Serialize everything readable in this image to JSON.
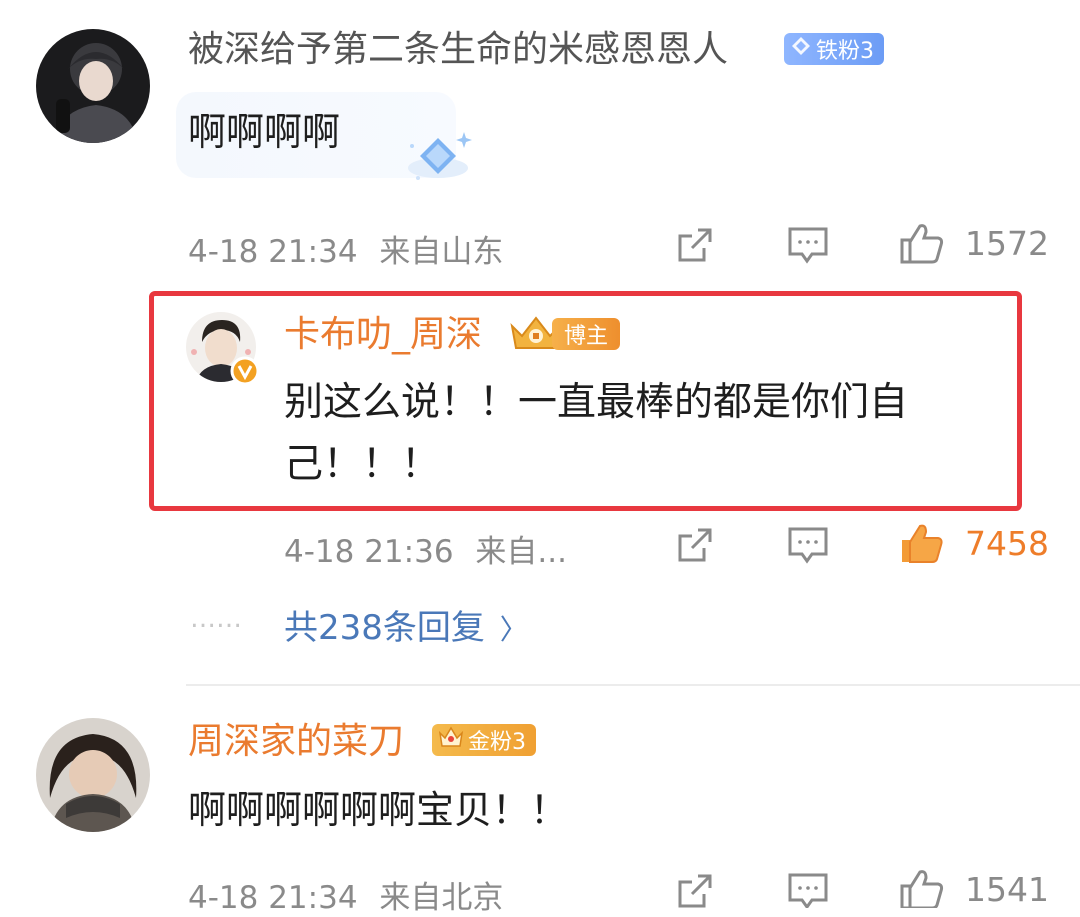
{
  "comments": [
    {
      "username": "被深给予第二条生命的米感恩恩人",
      "badge": "铁粉3",
      "text": "啊啊啊啊",
      "time": "4-18 21:34",
      "location": "来自山东",
      "likes": "1572"
    },
    {
      "username": "周深家的菜刀",
      "badge": "金粉3",
      "text": "啊啊啊啊啊啊宝贝！！",
      "time": "4-18 21:34",
      "location": "来自北京",
      "likes": "1541"
    }
  ],
  "reply": {
    "username": "卡布叻_周深",
    "badge": "博主",
    "text_line1": "别这么说！！一直最棒的都是你们自",
    "text_line2": "己！！！",
    "time": "4-18 21:36",
    "location": "来自...",
    "likes": "7458",
    "highlight_color": "#e8383f"
  },
  "more_replies": {
    "dots": "……",
    "label": "共238条回复",
    "chevron": "〉"
  },
  "colors": {
    "orange_accent": "#ea7b2f",
    "link_blue": "#4a78b8",
    "meta_gray": "#8a8a8a"
  },
  "icons": [
    "share-icon",
    "comment-icon",
    "like-icon",
    "diamond-icon",
    "crown-icon",
    "verified-icon",
    "chevron-right-icon"
  ]
}
